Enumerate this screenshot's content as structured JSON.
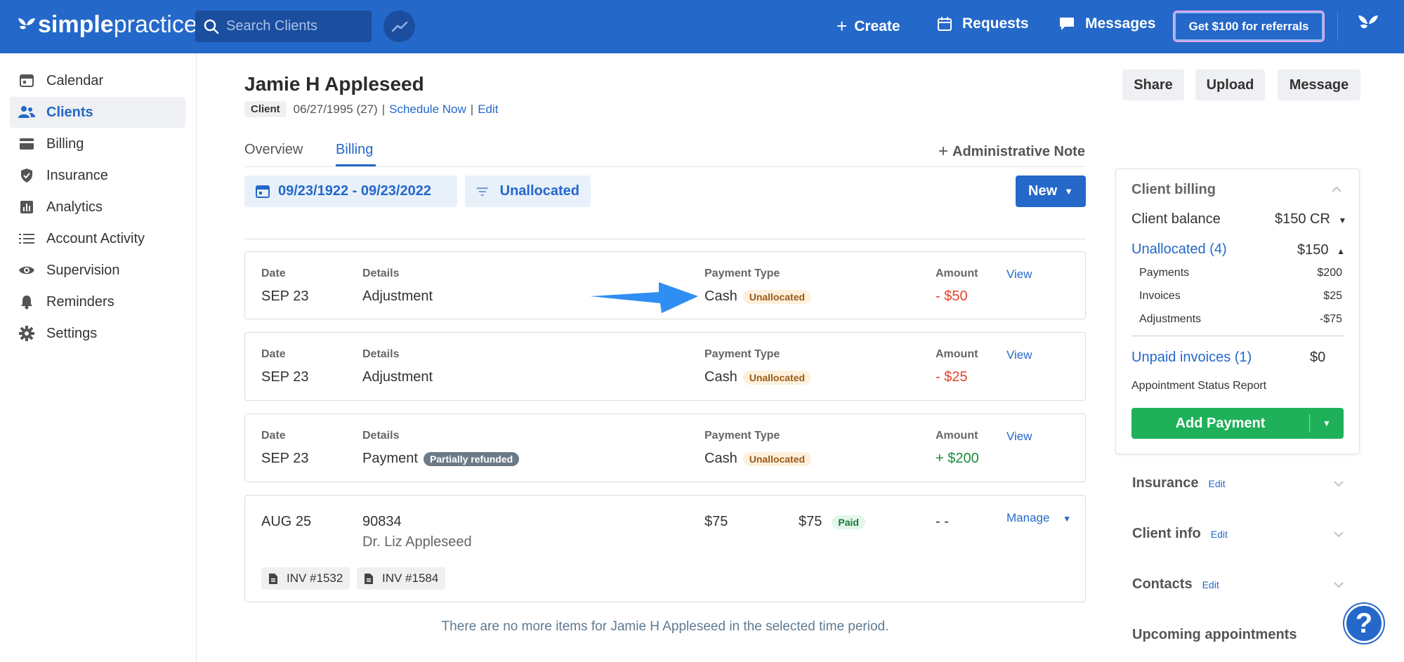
{
  "header": {
    "logo_bold": "simple",
    "logo_light": "practice",
    "search_placeholder": "Search Clients",
    "create": "Create",
    "requests": "Requests",
    "messages": "Messages",
    "referral": "Get $100 for referrals",
    "brand_color": "#2468c9"
  },
  "sidebar": {
    "items": [
      {
        "label": "Calendar",
        "icon": "calendar-icon"
      },
      {
        "label": "Clients",
        "icon": "clients-icon",
        "active": true
      },
      {
        "label": "Billing",
        "icon": "billing-card-icon"
      },
      {
        "label": "Insurance",
        "icon": "shield-icon"
      },
      {
        "label": "Analytics",
        "icon": "analytics-icon"
      },
      {
        "label": "Account Activity",
        "icon": "list-icon"
      },
      {
        "label": "Supervision",
        "icon": "eye-icon"
      },
      {
        "label": "Reminders",
        "icon": "bell-icon"
      },
      {
        "label": "Settings",
        "icon": "gear-icon"
      }
    ]
  },
  "client": {
    "name": "Jamie H Appleseed",
    "chip": "Client",
    "dob": "06/27/1995 (27)",
    "sep": "|",
    "schedule": "Schedule Now",
    "edit": "Edit"
  },
  "actions": {
    "share": "Share",
    "upload": "Upload",
    "message": "Message"
  },
  "tabs": {
    "overview": "Overview",
    "billing": "Billing",
    "admin_note": "Administrative Note"
  },
  "filters": {
    "date_range": "09/23/1922 - 09/23/2022",
    "status": "Unallocated",
    "new": "New"
  },
  "labels": {
    "date": "Date",
    "details": "Details",
    "payment_type": "Payment Type",
    "amount": "Amount",
    "view": "View",
    "manage": "Manage"
  },
  "transactions": [
    {
      "date": "SEP 23",
      "details": "Adjustment",
      "type": "Cash",
      "badge": "Unallocated",
      "amount": "- $50"
    },
    {
      "date": "SEP 23",
      "details": "Adjustment",
      "type": "Cash",
      "badge": "Unallocated",
      "amount": "- $25"
    },
    {
      "date": "SEP 23",
      "details": "Payment",
      "detail_badge": "Partially refunded",
      "type": "Cash",
      "badge": "Unallocated",
      "amount": "+ $200"
    }
  ],
  "invoice_row": {
    "date": "AUG 25",
    "code": "90834",
    "provider": "Dr. Liz Appleseed",
    "fee": "$75",
    "paid_amount": "$75",
    "badge": "Paid",
    "amount": "- -",
    "invoices": [
      "INV #1532",
      "INV #1584"
    ]
  },
  "no_more": "There are no more items for Jamie H Appleseed in the selected time period.",
  "panel": {
    "title": "Client billing",
    "balance_label": "Client balance",
    "balance_value": "$150 CR",
    "unallocated_label": "Unallocated (4)",
    "unallocated_value": "$150",
    "rows": [
      {
        "label": "Payments",
        "value": "$200"
      },
      {
        "label": "Invoices",
        "value": "$25"
      },
      {
        "label": "Adjustments",
        "value": "-$75"
      }
    ],
    "unpaid_label": "Unpaid invoices (1)",
    "unpaid_value": "$0",
    "report": "Appointment Status Report",
    "add_payment": "Add Payment"
  },
  "sections": [
    {
      "title": "Insurance",
      "edit": "Edit"
    },
    {
      "title": "Client info",
      "edit": "Edit"
    },
    {
      "title": "Contacts",
      "edit": "Edit"
    },
    {
      "title": "Upcoming appointments"
    }
  ],
  "help": "?"
}
